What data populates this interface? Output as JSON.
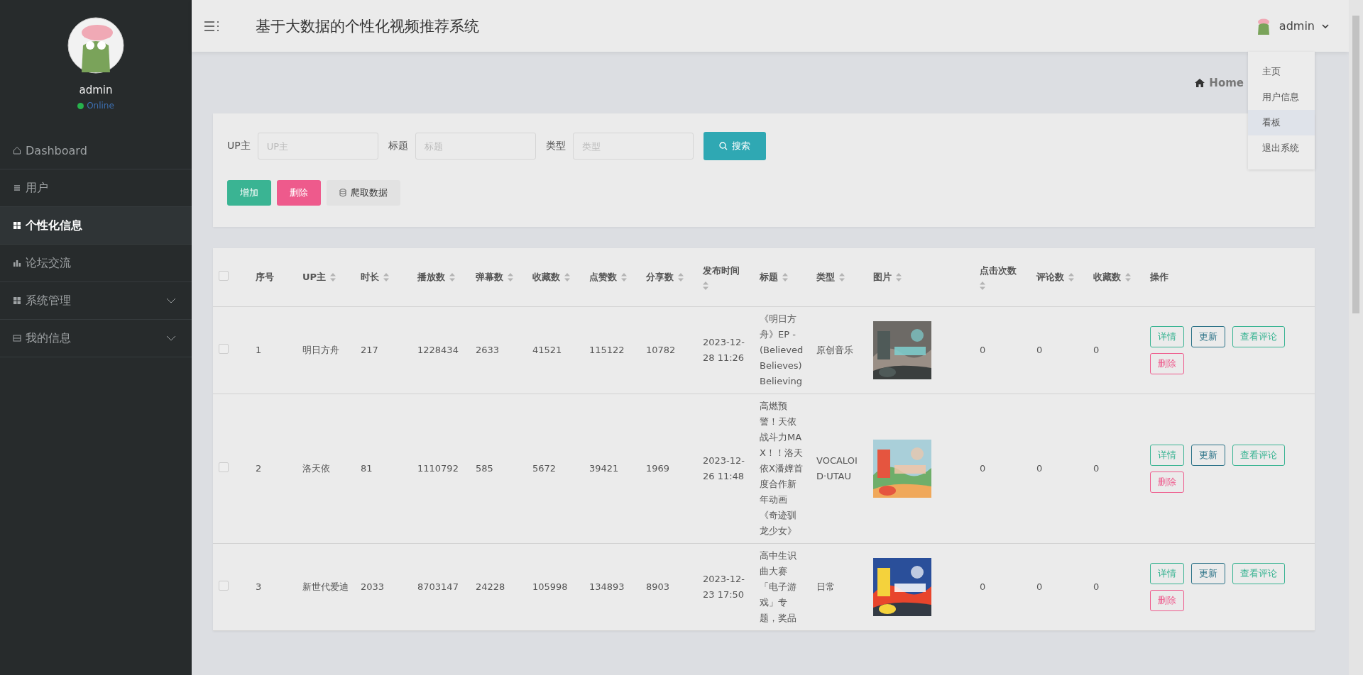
{
  "sidebar": {
    "user": "admin",
    "status": "Online",
    "items": [
      {
        "label": "Dashboard",
        "kind": "home",
        "selected": false,
        "expandable": false
      },
      {
        "label": "用户",
        "kind": "list",
        "selected": false,
        "expandable": false
      },
      {
        "label": "个性化信息",
        "kind": "grid",
        "selected": true,
        "expandable": false
      },
      {
        "label": "论坛交流",
        "kind": "chart",
        "selected": false,
        "expandable": false
      },
      {
        "label": "系统管理",
        "kind": "grid",
        "selected": false,
        "expandable": true
      },
      {
        "label": "我的信息",
        "kind": "card",
        "selected": false,
        "expandable": true
      }
    ]
  },
  "header": {
    "title": "基于大数据的个性化视频推荐系统",
    "user": "admin"
  },
  "user_menu": {
    "items": [
      {
        "label": "主页",
        "selected": false
      },
      {
        "label": "用户信息",
        "selected": false
      },
      {
        "label": "看板",
        "selected": true
      },
      {
        "label": "退出系统",
        "selected": false
      }
    ]
  },
  "breadcrumb": "Home",
  "search": {
    "fields": [
      {
        "label": "UP主",
        "placeholder": "UP主"
      },
      {
        "label": "标题",
        "placeholder": "标题"
      },
      {
        "label": "类型",
        "placeholder": "类型"
      }
    ],
    "button": "搜索"
  },
  "actions": [
    {
      "label": "增加",
      "kind": "add"
    },
    {
      "label": "删除",
      "kind": "delete"
    },
    {
      "label": "爬取数据",
      "kind": "crawl"
    }
  ],
  "table": {
    "all_selected": false,
    "columns": [
      {
        "label": "序号",
        "kind": "text",
        "sortable": false
      },
      {
        "label": "UP主",
        "kind": "text",
        "sortable": true
      },
      {
        "label": "时长",
        "kind": "text",
        "sortable": true
      },
      {
        "label": "播放数",
        "kind": "text",
        "sortable": true
      },
      {
        "label": "弹幕数",
        "kind": "text",
        "sortable": true
      },
      {
        "label": "收藏数",
        "kind": "text",
        "sortable": true
      },
      {
        "label": "点赞数",
        "kind": "text",
        "sortable": true
      },
      {
        "label": "分享数",
        "kind": "text",
        "sortable": true
      },
      {
        "label": "发布时间",
        "kind": "text",
        "sortable": true
      },
      {
        "label": "标题",
        "kind": "text",
        "sortable": true
      },
      {
        "label": "类型",
        "kind": "text",
        "sortable": true
      },
      {
        "label": "图片",
        "kind": "picture",
        "sortable": true
      },
      {
        "label": "点击次数",
        "kind": "text",
        "sortable": true
      },
      {
        "label": "评论数",
        "kind": "text",
        "sortable": true
      },
      {
        "label": "收藏数",
        "kind": "text",
        "sortable": true
      },
      {
        "label": "操作",
        "kind": "actions",
        "sortable": false
      }
    ],
    "rows": [
      {
        "selected": false,
        "cells": [
          "1",
          "明日方舟",
          "217",
          "1228434",
          "2633",
          "41521",
          "115122",
          "10782",
          "2023-12-28 11:26",
          "《明日方舟》EP - (Believed Believes) Believing",
          "原创音乐",
          {
            "kind": "picture"
          },
          "0",
          "0",
          "0"
        ],
        "actions": [
          {
            "label": "详情",
            "color": "#3ab493"
          },
          {
            "label": "更新",
            "color": "#2b7287"
          },
          {
            "label": "查看评论",
            "color": "#3ab493"
          },
          {
            "label": "删除",
            "color": "#ee5a8c"
          }
        ]
      },
      {
        "selected": false,
        "cells": [
          "2",
          "洛天依",
          "81",
          "1110792",
          "585",
          "5672",
          "39421",
          "1969",
          "2023-12-26 11:48",
          "高燃预警！天依战斗力MAX！！洛天依X潘嫜首度合作新年动画《奇迹驯龙少女》",
          "VOCALOID·UTAU",
          {
            "kind": "picture"
          },
          "0",
          "0",
          "0"
        ],
        "actions": [
          {
            "label": "详情",
            "color": "#3ab493"
          },
          {
            "label": "更新",
            "color": "#2b7287"
          },
          {
            "label": "查看评论",
            "color": "#3ab493"
          },
          {
            "label": "删除",
            "color": "#ee5a8c"
          }
        ]
      },
      {
        "selected": false,
        "cells": [
          "3",
          "新世代爱迪",
          "2033",
          "8703147",
          "24228",
          "105998",
          "134893",
          "8903",
          "2023-12-23 17:50",
          "高中生识曲大赛「电子游戏」专题，奖品",
          "日常",
          {
            "kind": "picture"
          },
          "0",
          "0",
          "0"
        ],
        "actions": [
          {
            "label": "详情",
            "color": "#3ab493"
          },
          {
            "label": "更新",
            "color": "#2b7287"
          },
          {
            "label": "查看评论",
            "color": "#3ab493"
          },
          {
            "label": "删除",
            "color": "#ee5a8c"
          }
        ]
      }
    ]
  }
}
